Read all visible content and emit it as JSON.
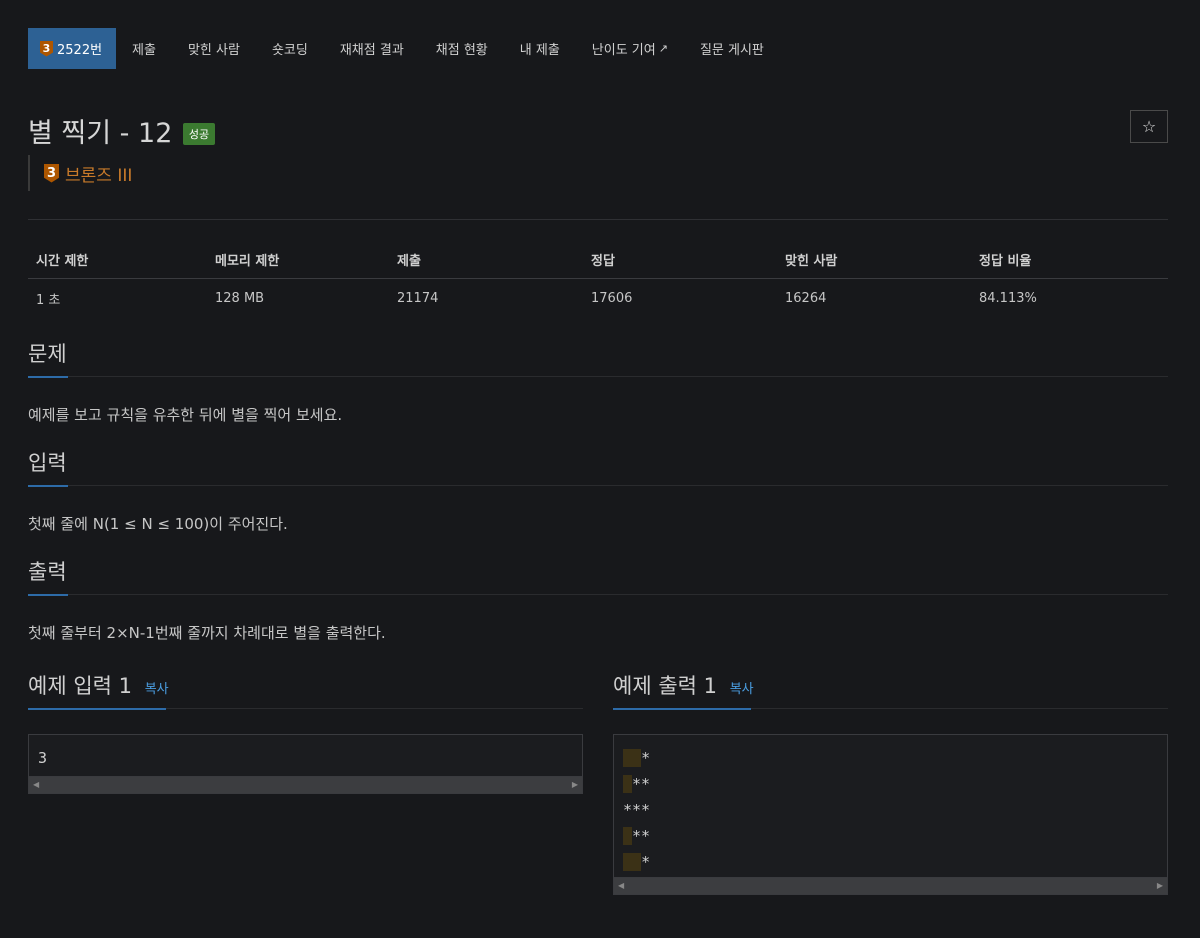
{
  "tabs": [
    {
      "label": "2522번",
      "tier_num": "3",
      "active": true
    },
    {
      "label": "제출"
    },
    {
      "label": "맞힌 사람"
    },
    {
      "label": "숏코딩"
    },
    {
      "label": "재채점 결과"
    },
    {
      "label": "채점 현황"
    },
    {
      "label": "내 제출"
    },
    {
      "label": "난이도 기여",
      "external": true
    },
    {
      "label": "질문 게시판"
    }
  ],
  "problem": {
    "title": "별 찍기 - 12",
    "status_badge": "성공",
    "tier_num": "3",
    "tier_label": "브론즈 III"
  },
  "info_table": {
    "headers": [
      "시간 제한",
      "메모리 제한",
      "제출",
      "정답",
      "맞힌 사람",
      "정답 비율"
    ],
    "values": [
      "1 초",
      "128 MB",
      "21174",
      "17606",
      "16264",
      "84.113%"
    ]
  },
  "sections": {
    "problem": {
      "title": "문제",
      "text": "예제를 보고 규칙을 유추한 뒤에 별을 찍어 보세요."
    },
    "input": {
      "title": "입력",
      "text": "첫째 줄에 N(1 ≤ N ≤ 100)이 주어진다."
    },
    "output": {
      "title": "출력",
      "text": "첫째 줄부터 2×N-1번째 줄까지 차례대로 별을 출력한다."
    }
  },
  "samples": {
    "input": {
      "title": "예제 입력 1",
      "copy": "복사",
      "content": "3"
    },
    "output": {
      "title": "예제 출력 1",
      "copy": "복사",
      "lines": [
        {
          "spaces": "  ",
          "stars": "*"
        },
        {
          "spaces": " ",
          "stars": "**"
        },
        {
          "spaces": "",
          "stars": "***"
        },
        {
          "spaces": " ",
          "stars": "**"
        },
        {
          "spaces": "  ",
          "stars": "*"
        }
      ]
    }
  },
  "colors": {
    "accent": "#2d6194",
    "bronze": "#ad5600",
    "success": "#3b7a30",
    "link": "#4a9de0"
  }
}
